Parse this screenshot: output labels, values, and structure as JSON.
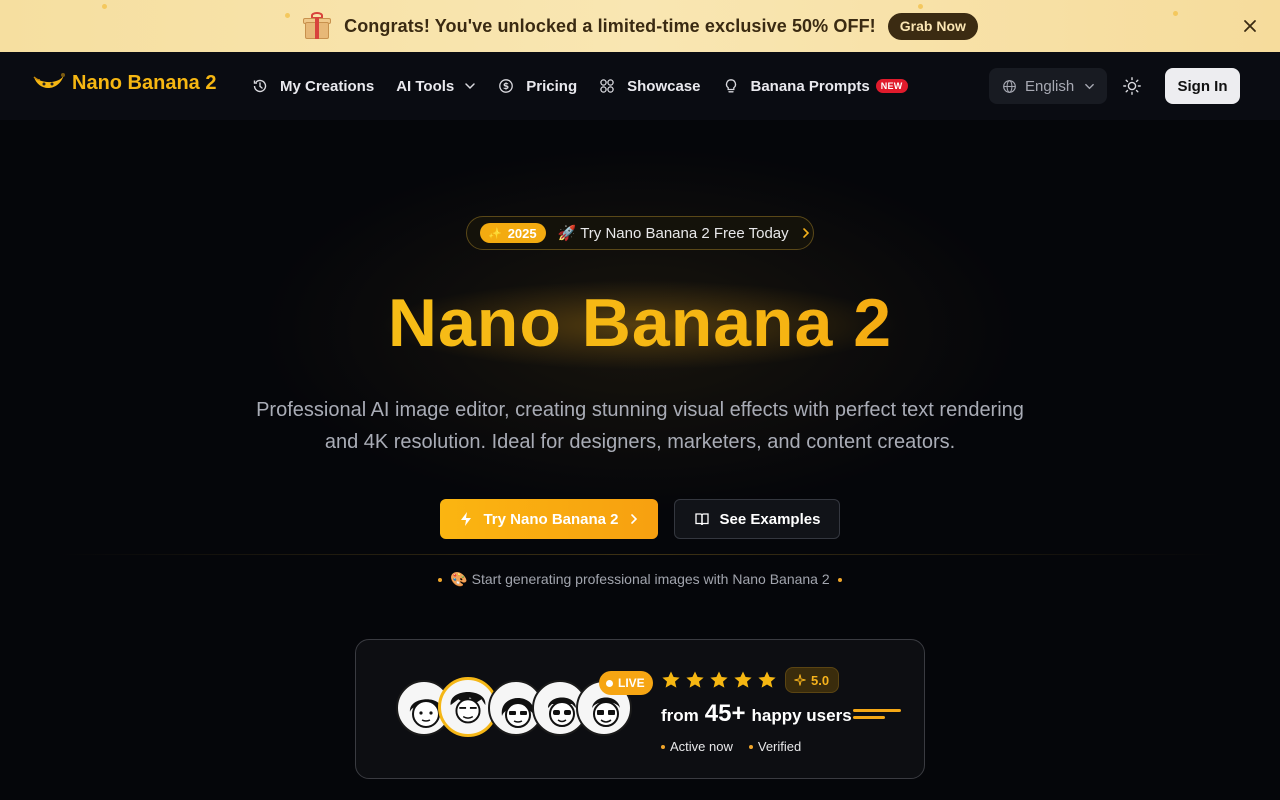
{
  "promo": {
    "text": "Congrats! You've unlocked a limited-time exclusive 50% OFF!",
    "button_label": "Grab Now",
    "icon": "gift-icon"
  },
  "nav": {
    "brand": "Nano Banana 2",
    "items": [
      {
        "label": "My Creations",
        "icon": "history-icon"
      },
      {
        "label": "AI Tools",
        "icon": "chevron-down-icon"
      },
      {
        "label": "Pricing",
        "icon": "dollar-icon"
      },
      {
        "label": "Showcase",
        "icon": "grid-icon"
      },
      {
        "label": "Banana Prompts",
        "icon": "lightbulb-icon",
        "badge": "NEW"
      }
    ],
    "language": "English",
    "sign_in": "Sign In"
  },
  "hero": {
    "pill_year": "2025",
    "pill_text": "🚀 Try Nano Banana 2 Free Today",
    "title": "Nano Banana 2",
    "subtitle": "Professional AI image editor, creating stunning visual effects with perfect text rendering and 4K resolution. Ideal for designers, marketers, and content creators.",
    "primary_button": "Try Nano Banana 2",
    "secondary_button": "See Examples",
    "start_line": "🎨 Start generating professional images with Nano Banana 2"
  },
  "social_proof": {
    "live_label": "LIVE",
    "rating": "5.0",
    "stars": 5,
    "users_prefix": "from",
    "users_count": "45+",
    "users_suffix": "happy users",
    "status_active": "Active now",
    "status_verified": "Verified"
  },
  "colors": {
    "accent": "#f6b712",
    "accent_orange": "#f28c14",
    "badge_red": "#e01b2c",
    "promo_bg": "#f8e2a8"
  }
}
